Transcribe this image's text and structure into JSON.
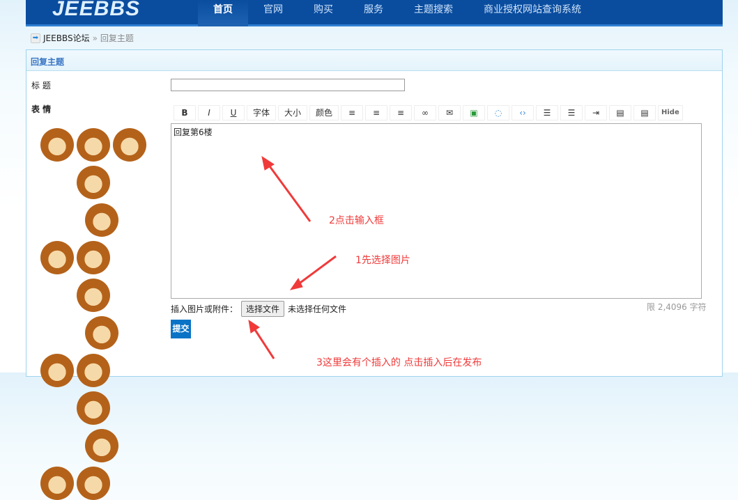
{
  "header": {
    "logo": "JEEBBS",
    "nav": [
      "首页",
      "官网",
      "购买",
      "服务",
      "主题搜索",
      "商业授权网站查询系统"
    ]
  },
  "breadcrumb": {
    "home": "JEEBBS论坛",
    "sep": "»",
    "current": "回复主题"
  },
  "panel": {
    "title": "回复主题",
    "title_label": "标 题",
    "title_value": "",
    "emotion_label": "表 情"
  },
  "toolbar": [
    "B",
    "I",
    "U",
    "字体",
    "大小",
    "颜色",
    "≡",
    "≡",
    "≡",
    "∞",
    "✉",
    "▣",
    "◌",
    "‹›",
    "☰",
    "☰",
    "⇥",
    "▤",
    "▤",
    "Hide"
  ],
  "editor": {
    "content": "回复第6楼"
  },
  "file": {
    "label": "插入图片或附件：",
    "button": "选择文件",
    "status": "未选择任何文件"
  },
  "limit": "限 2,4096 字符",
  "submit": "提交",
  "notes": {
    "n1": "1先选择图片",
    "n2": "2点击输入框",
    "n3": "3这里会有个插入的 点击插入后在发布"
  },
  "colors": {
    "header": "#0a4d9f",
    "note": "#f03a3a"
  }
}
